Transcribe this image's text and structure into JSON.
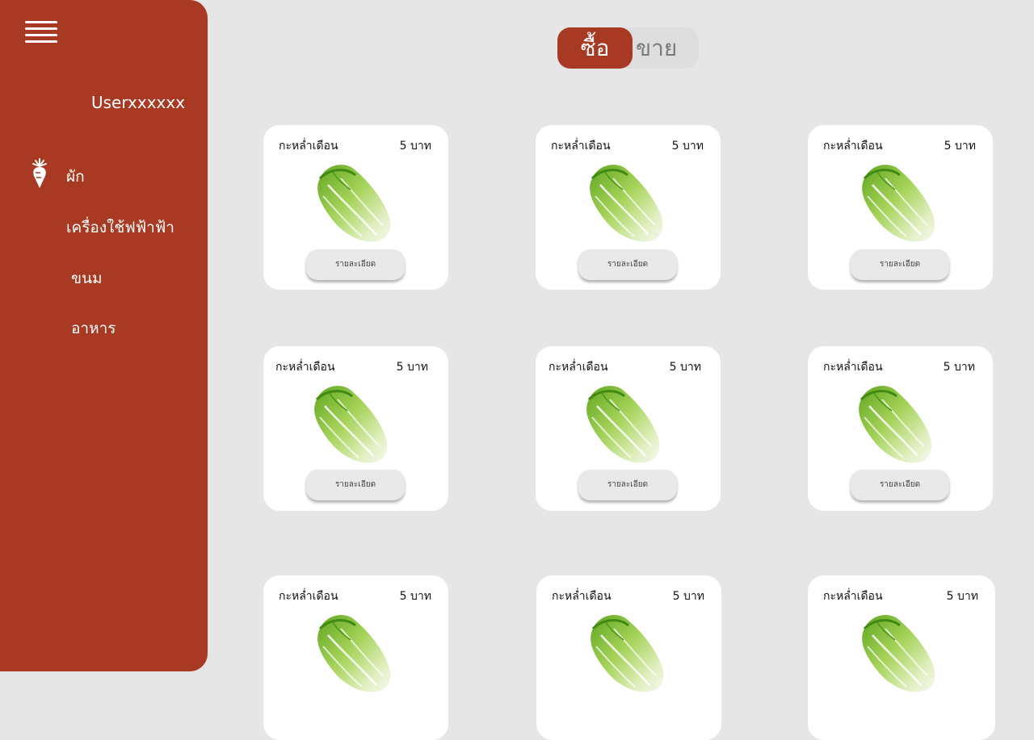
{
  "sidebar": {
    "username": "Userxxxxxx",
    "categories": [
      {
        "label": "ผัก",
        "icon": "carrot-icon"
      },
      {
        "label": "เครื่องใช้ฟฟ้าฟ้า"
      },
      {
        "label": "ขนม"
      },
      {
        "label": "อาหาร"
      }
    ]
  },
  "toggle": {
    "buy_label": "ซื้อ",
    "sell_label": "ขาย",
    "active": "buy"
  },
  "colors": {
    "brand": "#a83a23",
    "background": "#e6e6e6",
    "card": "#ffffff"
  },
  "products": [
    {
      "name": "กะหล่ำเดือน",
      "price": "5 บาท",
      "button": "รายละเอียด"
    },
    {
      "name": "กะหล่ำเดือน",
      "price": "5 บาท",
      "button": "รายละเอียด"
    },
    {
      "name": "กะหล่ำเดือน",
      "price": "5 บาท",
      "button": "รายละเอียด"
    },
    {
      "name": "กะหล่ำเดือน",
      "price": "5 บาท",
      "button": "รายละเอียด"
    },
    {
      "name": "กะหล่ำเดือน",
      "price": "5 บาท",
      "button": "รายละเอียด"
    },
    {
      "name": "กะหล่ำเดือน",
      "price": "5 บาท",
      "button": "รายละเอียด"
    },
    {
      "name": "กะหล่ำเดือน",
      "price": "5 บาท"
    },
    {
      "name": "กะหล่ำเดือน",
      "price": "5 บาท"
    },
    {
      "name": "กะหล่ำเดือน",
      "price": "5 บาท"
    }
  ]
}
